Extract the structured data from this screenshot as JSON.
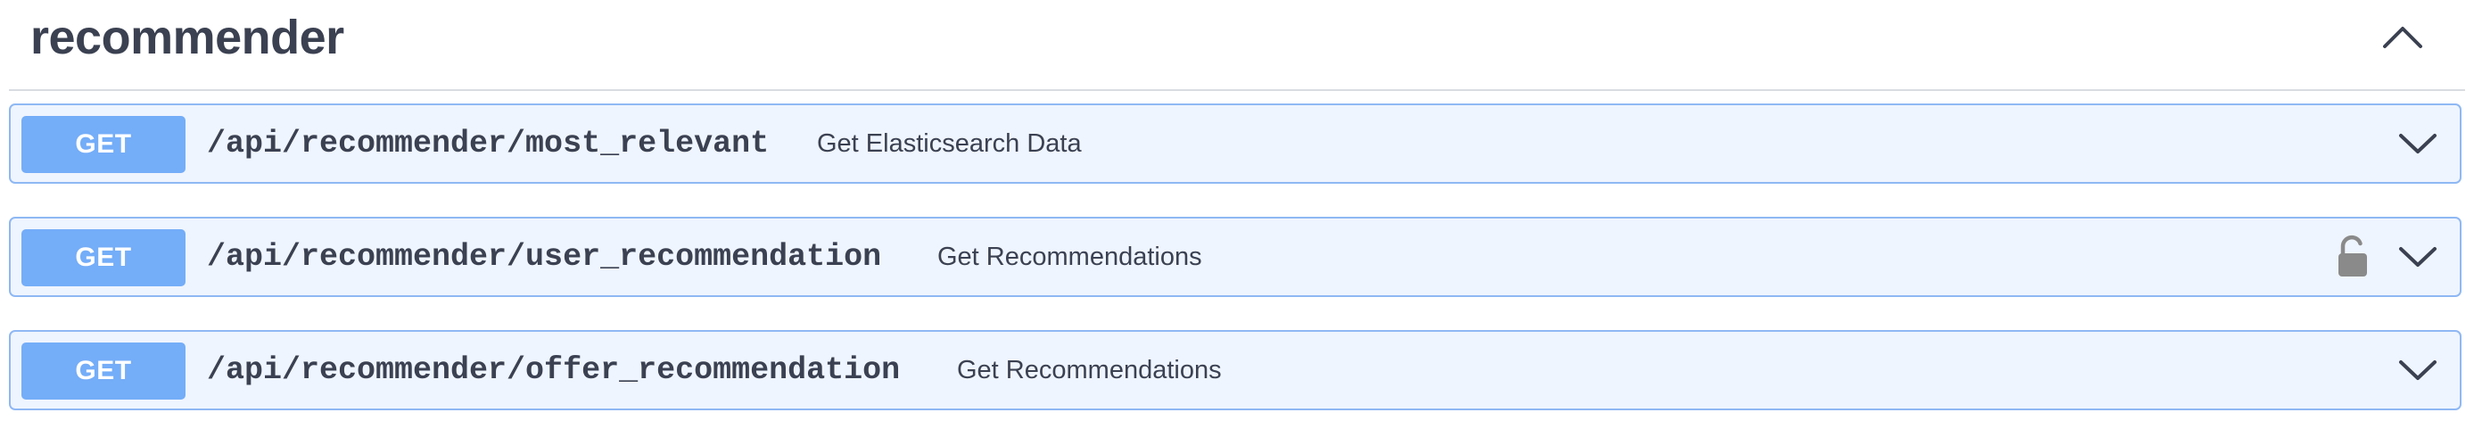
{
  "section": {
    "title": "recommender",
    "toggle_icon": "chevron-up-icon"
  },
  "operations": [
    {
      "method": "GET",
      "path": "/api/recommender/most_relevant",
      "summary": "Get Elasticsearch Data",
      "locked": false,
      "expand_icon": "chevron-down-icon"
    },
    {
      "method": "GET",
      "path": "/api/recommender/user_recommendation",
      "summary": "Get Recommendations",
      "locked": true,
      "lock_icon": "unlocked-padlock-icon",
      "expand_icon": "chevron-down-icon"
    },
    {
      "method": "GET",
      "path": "/api/recommender/offer_recommendation",
      "summary": "Get Recommendations",
      "locked": false,
      "expand_icon": "chevron-down-icon"
    }
  ],
  "colors": {
    "get_method": "#74adf8",
    "opblock_bg": "#eff5fe",
    "opblock_border": "#8fb8f4",
    "text": "#3b4151",
    "lock": "#8a8a8a"
  }
}
